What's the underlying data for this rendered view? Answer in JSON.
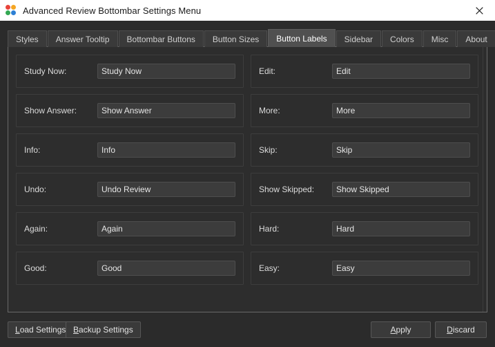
{
  "window": {
    "title": "Advanced Review Bottombar Settings Menu",
    "icon": "anki-dots-icon",
    "close_label": "close-icon"
  },
  "tabs": [
    {
      "label": "Styles",
      "active": false
    },
    {
      "label": "Answer Tooltip",
      "active": false
    },
    {
      "label": "Bottombar Buttons",
      "active": false
    },
    {
      "label": "Button Sizes",
      "active": false
    },
    {
      "label": "Button Labels",
      "active": true
    },
    {
      "label": "Sidebar",
      "active": false
    },
    {
      "label": "Colors",
      "active": false
    },
    {
      "label": "Misc",
      "active": false
    },
    {
      "label": "About",
      "active": false
    }
  ],
  "button_labels": {
    "left_column": [
      {
        "label": "Study Now:",
        "value": "Study Now"
      },
      {
        "label": "Show Answer:",
        "value": "Show Answer"
      },
      {
        "label": "Info:",
        "value": "Info"
      },
      {
        "label": "Undo:",
        "value": "Undo Review"
      },
      {
        "label": "Again:",
        "value": "Again"
      },
      {
        "label": "Good:",
        "value": "Good"
      }
    ],
    "right_column": [
      {
        "label": "Edit:",
        "value": "Edit"
      },
      {
        "label": "More:",
        "value": "More"
      },
      {
        "label": "Skip:",
        "value": "Skip"
      },
      {
        "label": "Show Skipped:",
        "value": "Show Skipped"
      },
      {
        "label": "Hard:",
        "value": "Hard"
      },
      {
        "label": "Easy:",
        "value": "Easy"
      }
    ]
  },
  "footer": {
    "load_settings": {
      "mnemonic": "L",
      "rest": "oad Settings"
    },
    "backup_settings": {
      "mnemonic": "B",
      "rest": "ackup Settings"
    },
    "apply": {
      "mnemonic": "A",
      "rest": "pply"
    },
    "discard": {
      "mnemonic": "D",
      "rest": "iscard"
    }
  },
  "colors": {
    "dialog_bg": "#2b2b2b",
    "pane_bg": "#2d2d2d",
    "titlebar_bg": "#ffffff",
    "active_tab_bg": "#505050",
    "tab_bg": "#3a3a3a",
    "field_bg": "#3c3c3c",
    "text": "#dcdcdc"
  }
}
